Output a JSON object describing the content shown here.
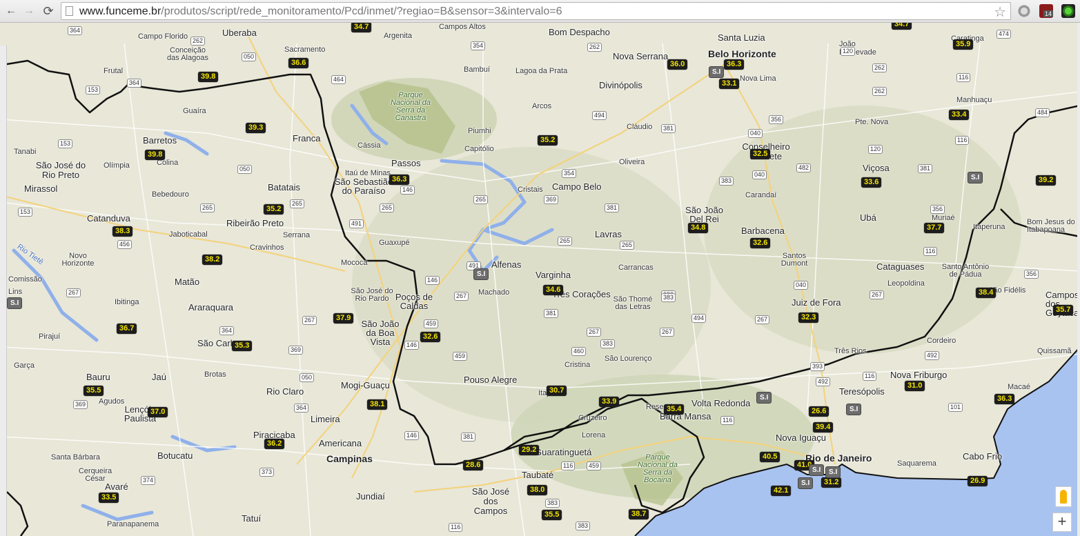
{
  "browser": {
    "url_host": "www.funceme.br",
    "url_path": "/produtos/script/rede_monitoramento/Pcd/inmet/?regiao=B&sensor=3&intervalo=6",
    "back_glyph": "←",
    "forward_glyph": "→",
    "reload_glyph": "⟳",
    "star_glyph": "☆",
    "ext_badge": "14"
  },
  "map": {
    "places": [
      {
        "t": "Uberaba",
        "c": "big"
      },
      {
        "t": "Campo Florido"
      },
      {
        "t": "Conceição das Alagoas"
      },
      {
        "t": "Sacramento"
      },
      {
        "t": "Argenita"
      },
      {
        "t": "Campos Altos"
      },
      {
        "t": "Bom Despacho",
        "c": "big"
      },
      {
        "t": "Santa Luzia",
        "c": "big"
      },
      {
        "t": "Caratinga"
      },
      {
        "t": "Frutal"
      },
      {
        "t": "Bambuí"
      },
      {
        "t": "Lagoa da Prata"
      },
      {
        "t": "Nova Serrana",
        "c": "big"
      },
      {
        "t": "Belo Horizonte",
        "c": "bold"
      },
      {
        "t": "João Monlevade"
      },
      {
        "t": "Nova Lima"
      },
      {
        "t": "Divinópolis",
        "c": "big"
      },
      {
        "t": "Manhuaçu"
      },
      {
        "t": "Guaíra"
      },
      {
        "t": "Arcos"
      },
      {
        "t": "Cláudio"
      },
      {
        "t": "Pte. Nova"
      },
      {
        "t": "Piumhi"
      },
      {
        "t": "Capitólio"
      },
      {
        "t": "Conselheiro Lafaiete",
        "c": "big"
      },
      {
        "t": "Barretos",
        "c": "big"
      },
      {
        "t": "Franca",
        "c": "big"
      },
      {
        "t": "Cássia"
      },
      {
        "t": "Oliveira"
      },
      {
        "t": "Olímpia"
      },
      {
        "t": "Colina"
      },
      {
        "t": "São José do Rio Preto",
        "c": "big"
      },
      {
        "t": "Passos",
        "c": "big"
      },
      {
        "t": "Itaú de Minas"
      },
      {
        "t": "São Sebastião do Paraíso",
        "c": "big"
      },
      {
        "t": "Viçosa",
        "c": "big"
      },
      {
        "t": "Mirassol",
        "c": "big"
      },
      {
        "t": "Batatais"
      },
      {
        "t": "Cristais"
      },
      {
        "t": "Campo Belo",
        "c": "big"
      },
      {
        "t": "Bebedouro"
      },
      {
        "t": "Carandaí"
      },
      {
        "t": "São João Del Rei",
        "c": "big"
      },
      {
        "t": "Catanduva",
        "c": "big"
      },
      {
        "t": "Ribeirão Preto",
        "c": "big"
      },
      {
        "t": "Ubá",
        "c": "big"
      },
      {
        "t": "Muriaé"
      },
      {
        "t": "Jaboticabal"
      },
      {
        "t": "Serrana"
      },
      {
        "t": "Lavras",
        "c": "big"
      },
      {
        "t": "Barbacena",
        "c": "big"
      },
      {
        "t": "Itaperuna"
      },
      {
        "t": "Bom Jesus do Itabapoana"
      },
      {
        "t": "Cravinhos"
      },
      {
        "t": "Guaxupé"
      },
      {
        "t": "Santos Dumont"
      },
      {
        "t": "Novo Horizonte"
      },
      {
        "t": "Mococa"
      },
      {
        "t": "Alfenas",
        "c": "big"
      },
      {
        "t": "Carrancas"
      },
      {
        "t": "Cataguases",
        "c": "big"
      },
      {
        "t": "Santo Antônio de Pádua"
      },
      {
        "t": "Rio Tietê"
      },
      {
        "t": "Matão",
        "c": "big"
      },
      {
        "t": "Varginha",
        "c": "big"
      },
      {
        "t": "Leopoldina"
      },
      {
        "t": "São José do Rio Pardo"
      },
      {
        "t": "Poços de Caldas",
        "c": "big"
      },
      {
        "t": "Machado"
      },
      {
        "t": "Três Corações",
        "c": "big"
      },
      {
        "t": "São Thomé das Letras"
      },
      {
        "t": "São Fidélis"
      },
      {
        "t": "Campos dos Goytacazes",
        "c": "big"
      },
      {
        "t": "Ibitinga"
      },
      {
        "t": "Araraquara",
        "c": "big"
      },
      {
        "t": "Juiz de Fora",
        "c": "big"
      },
      {
        "t": "São João da Boa Vista",
        "c": "big"
      },
      {
        "t": "Pirajuí"
      },
      {
        "t": "São Carlos",
        "c": "big"
      },
      {
        "t": "Cordeiro"
      },
      {
        "t": "Três Rios"
      },
      {
        "t": "Quissamã"
      },
      {
        "t": "São Lourenço"
      },
      {
        "t": "Cristina"
      },
      {
        "t": "Garça"
      },
      {
        "t": "Brotas"
      },
      {
        "t": "Pouso Alegre",
        "c": "big"
      },
      {
        "t": "Nova Friburgo",
        "c": "big"
      },
      {
        "t": "Bauru",
        "c": "big"
      },
      {
        "t": "Jaú",
        "c": "big"
      },
      {
        "t": "Mogi-Guaçu",
        "c": "big"
      },
      {
        "t": "Rio Claro",
        "c": "big"
      },
      {
        "t": "Itajubá"
      },
      {
        "t": "Teresópolis",
        "c": "big"
      },
      {
        "t": "Volta Redonda",
        "c": "big"
      },
      {
        "t": "Macaé"
      },
      {
        "t": "Agudos"
      },
      {
        "t": "Lençóis Paulista",
        "c": "big"
      },
      {
        "t": "Resende"
      },
      {
        "t": "Barra Mansa",
        "c": "big"
      },
      {
        "t": "Limeira",
        "c": "big"
      },
      {
        "t": "Cruzeiro"
      },
      {
        "t": "Piracicaba",
        "c": "big"
      },
      {
        "t": "Americana",
        "c": "big"
      },
      {
        "t": "Lorena"
      },
      {
        "t": "Nova Iguaçu",
        "c": "big"
      },
      {
        "t": "Guaratinguetá",
        "c": "big"
      },
      {
        "t": "Campinas",
        "c": "bold"
      },
      {
        "t": "Botucatu",
        "c": "big"
      },
      {
        "t": "Rio de Janeiro",
        "c": "bold"
      },
      {
        "t": "Saquarema"
      },
      {
        "t": "Cabo Frio",
        "c": "big"
      },
      {
        "t": "Taubaté",
        "c": "big"
      },
      {
        "t": "Cerqueira César"
      },
      {
        "t": "Avaré",
        "c": "big"
      },
      {
        "t": "São José dos Campos",
        "c": "big"
      },
      {
        "t": "Jundiaí",
        "c": "big"
      },
      {
        "t": "Tatuí",
        "c": "big"
      },
      {
        "t": "Paranapanema"
      },
      {
        "t": "Santa Bárbara"
      },
      {
        "t": "Lins"
      },
      {
        "t": "Comissão"
      },
      {
        "t": "Tanabi"
      },
      {
        "t": "Parque Nacional da Serra da Canastra"
      },
      {
        "t": "Parque Nacional da Serra da Bocaina"
      }
    ],
    "highways": [
      "364",
      "262",
      "050",
      "153",
      "364",
      "464",
      "354",
      "262",
      "120",
      "262",
      "474",
      "116",
      "494",
      "381",
      "356",
      "262",
      "484",
      "040",
      "120",
      "116",
      "153",
      "050",
      "354",
      "482",
      "381",
      "383",
      "040",
      "265",
      "153",
      "491",
      "265",
      "146",
      "265",
      "369",
      "381",
      "265",
      "356",
      "456",
      "265",
      "265",
      "116",
      "267",
      "146",
      "491",
      "383",
      "040",
      "356",
      "267",
      "267",
      "364",
      "267",
      "459",
      "267",
      "381",
      "267",
      "383",
      "494",
      "267",
      "369",
      "146",
      "459",
      "460",
      "383",
      "393",
      "492",
      "116",
      "492",
      "050",
      "364",
      "116",
      "373",
      "146",
      "381",
      "116",
      "459",
      "101",
      "374",
      "383",
      "116",
      "383",
      "369"
    ],
    "readings": [
      "34.7",
      "34.7",
      "36.6",
      "39.8",
      "36.0",
      "36.3",
      "33.1",
      "35.9",
      "39.3",
      "35.2",
      "32.5",
      "33.4",
      "39.8",
      "36.3",
      "33.6",
      "39.2",
      "35.2",
      "34.8",
      "32.6",
      "37.7",
      "38.3",
      "38.2",
      "34.6",
      "38.4",
      "35.7",
      "37.9",
      "32.3",
      "32.6",
      "36.7",
      "35.3",
      "30.7",
      "31.0",
      "35.5",
      "33.9",
      "36.3",
      "37.0",
      "38.1",
      "35.4",
      "26.6",
      "39.4",
      "36.2",
      "29.2",
      "28.6",
      "40.5",
      "41.0",
      "38.0",
      "31.2",
      "42.1",
      "26.9",
      "33.5",
      "35.5",
      "38.7"
    ],
    "no_data_label": "S.I",
    "zoom_in_label": "+"
  }
}
